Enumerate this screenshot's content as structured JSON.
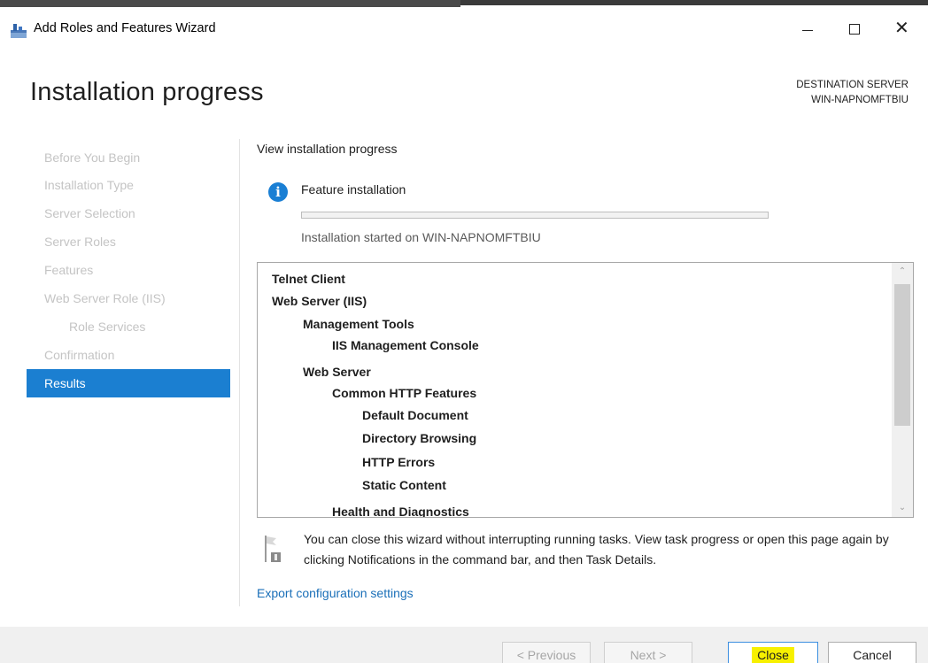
{
  "window": {
    "title": "Add Roles and Features Wizard",
    "minimize_icon": "minimize-icon",
    "maximize_icon": "maximize-icon",
    "close_glyph": "✕"
  },
  "header": {
    "page_title": "Installation progress",
    "destination_label": "DESTINATION SERVER",
    "destination_server": "WIN-NAPNOMFTBIU"
  },
  "nav": {
    "items": [
      {
        "label": "Before You Begin",
        "sub": false,
        "active": false
      },
      {
        "label": "Installation Type",
        "sub": false,
        "active": false
      },
      {
        "label": "Server Selection",
        "sub": false,
        "active": false
      },
      {
        "label": "Server Roles",
        "sub": false,
        "active": false
      },
      {
        "label": "Features",
        "sub": false,
        "active": false
      },
      {
        "label": "Web Server Role (IIS)",
        "sub": false,
        "active": false
      },
      {
        "label": "Role Services",
        "sub": true,
        "active": false
      },
      {
        "label": "Confirmation",
        "sub": false,
        "active": false
      },
      {
        "label": "Results",
        "sub": false,
        "active": true
      }
    ]
  },
  "progress": {
    "view_label": "View installation progress",
    "info_icon": "info-icon",
    "info_glyph": "i",
    "feature_label": "Feature installation",
    "percent": 0,
    "started_text": "Installation started on WIN-NAPNOMFTBIU"
  },
  "feature_list": [
    {
      "label": "Telnet Client",
      "level": 0
    },
    {
      "label": "Web Server (IIS)",
      "level": 0
    },
    {
      "label": "Management Tools",
      "level": 1
    },
    {
      "label": "IIS Management Console",
      "level": 2
    },
    {
      "label": "Web Server",
      "level": 1
    },
    {
      "label": "Common HTTP Features",
      "level": 2
    },
    {
      "label": "Default Document",
      "level": 3
    },
    {
      "label": "Directory Browsing",
      "level": 3
    },
    {
      "label": "HTTP Errors",
      "level": 3
    },
    {
      "label": "Static Content",
      "level": 3
    },
    {
      "label": "Health and Diagnostics",
      "level": 2
    }
  ],
  "note": {
    "icon": "flag-icon",
    "text": "You can close this wizard without interrupting running tasks. View task progress or open this page again by clicking Notifications in the command bar, and then Task Details."
  },
  "export_link": "Export configuration settings",
  "buttons": {
    "previous": "< Previous",
    "next": "Next >",
    "close": "Close",
    "cancel": "Cancel"
  },
  "colors": {
    "accent": "#1b7fd1",
    "link": "#1a6fb8",
    "close_highlight": "#f7f000"
  }
}
